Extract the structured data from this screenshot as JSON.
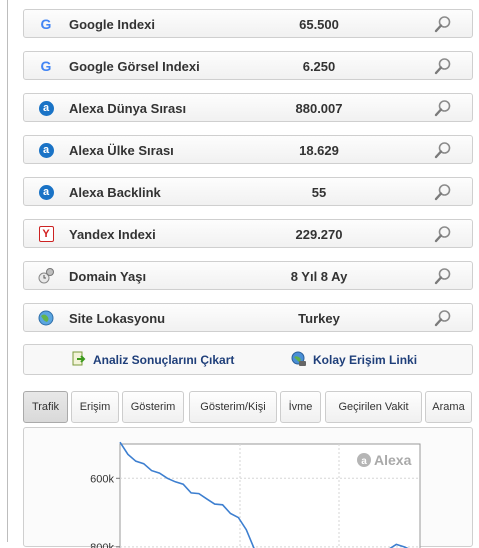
{
  "rows": [
    {
      "icon": "google-icon",
      "label": "Google Indexi",
      "value": "65.500"
    },
    {
      "icon": "google-icon",
      "label": "Google Görsel Indexi",
      "value": "6.250"
    },
    {
      "icon": "alexa-icon",
      "label": "Alexa Dünya Sırası",
      "value": "880.007"
    },
    {
      "icon": "alexa-icon",
      "label": "Alexa Ülke Sırası",
      "value": "18.629"
    },
    {
      "icon": "alexa-icon",
      "label": "Alexa Backlink",
      "value": "55"
    },
    {
      "icon": "yandex-icon",
      "label": "Yandex Indexi",
      "value": "229.270"
    },
    {
      "icon": "domain-age-icon",
      "label": "Domain Yaşı",
      "value": "8 Yıl 8 Ay"
    },
    {
      "icon": "globe-icon",
      "label": "Site Lokasyonu",
      "value": "Turkey"
    }
  ],
  "actions": {
    "export_label": "Analiz Sonuçlarını Çıkart",
    "easy_link_label": "Kolay Erişim Linki"
  },
  "tabs": [
    "Trafik",
    "Erişim",
    "Gösterim",
    "Gösterim/Kişi",
    "İvme",
    "Geçirilen Vakit",
    "Arama"
  ],
  "active_tab": "Trafik",
  "colors": {
    "line": "#3d7fd0",
    "tab_active": "#dddddd"
  },
  "chart_data": {
    "type": "line",
    "watermark": "Alexa",
    "y_tick_labels": [
      "600k",
      "800k"
    ],
    "ylim_visible": [
      500000,
      850000
    ],
    "y_reversed": true,
    "series": [
      {
        "values": [
          500000,
          530000,
          545000,
          560000,
          575000,
          590000,
          600000,
          605000,
          620000,
          640000,
          650000,
          660000,
          670000,
          680000,
          700000,
          720000,
          750000,
          800000,
          840000,
          null,
          null,
          null,
          null,
          null,
          null,
          null,
          null,
          null,
          null,
          null,
          null,
          null,
          840000,
          812000,
          805000,
          798000,
          800000,
          805000,
          820000
        ]
      }
    ]
  }
}
